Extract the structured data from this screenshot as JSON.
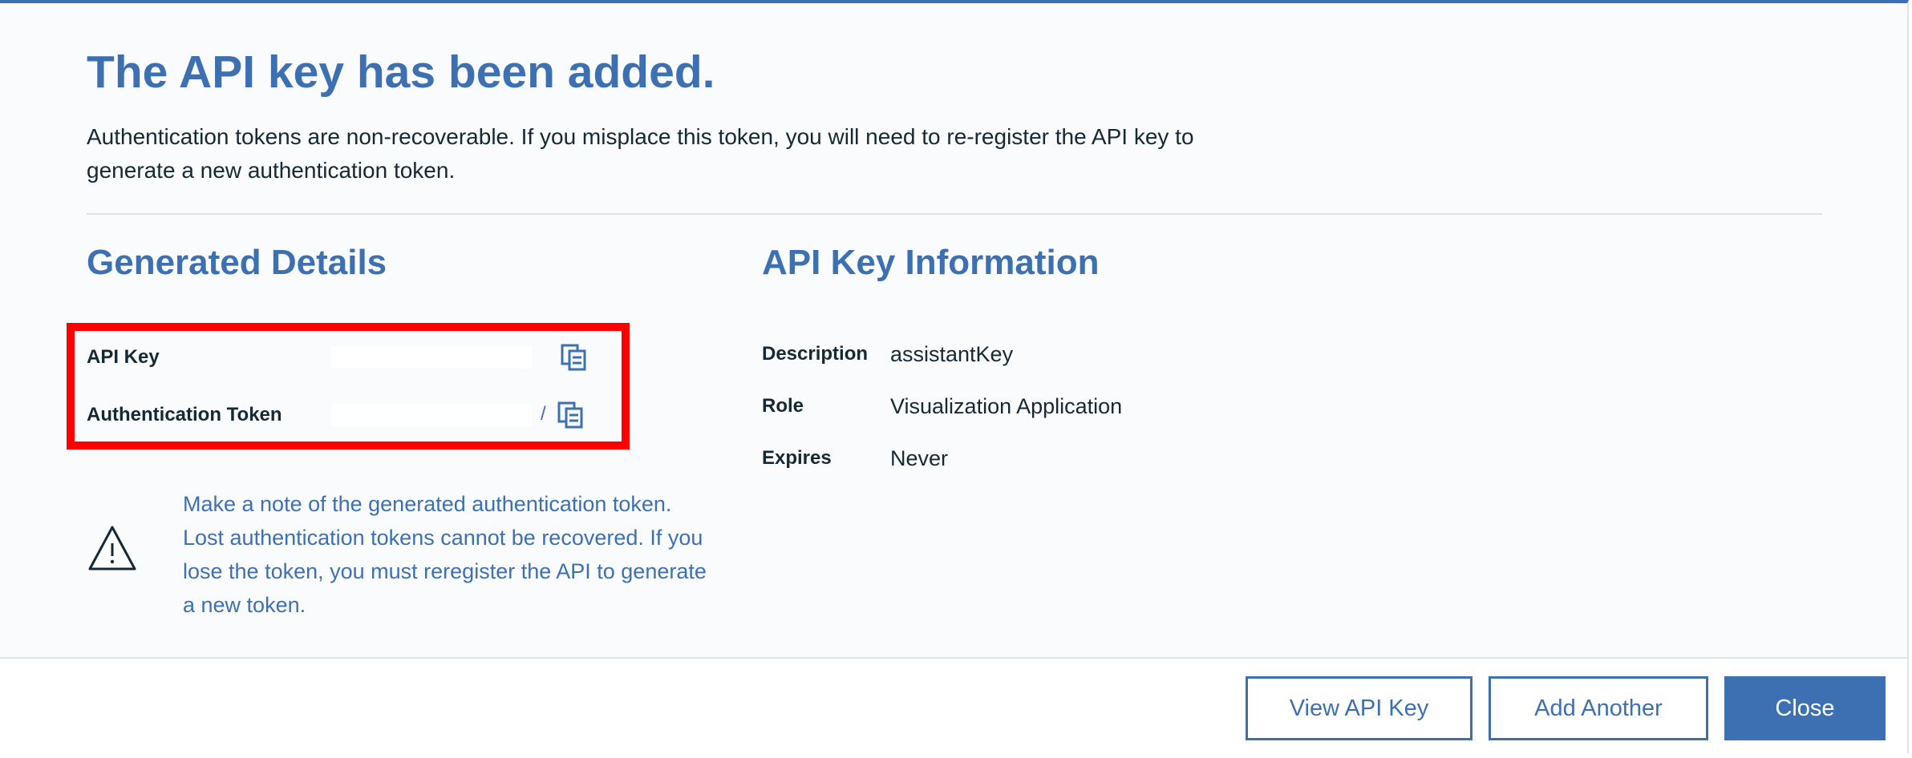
{
  "dialog": {
    "title": "The API key has been added.",
    "intro": "Authentication tokens are non-recoverable. If you misplace this token, you will need to re-register the API key to generate a new authentication token."
  },
  "generated_details": {
    "title": "Generated Details",
    "rows": [
      {
        "label": "API Key",
        "value_tail": ""
      },
      {
        "label": "Authentication Token",
        "value_tail": "/"
      }
    ],
    "copy_icon": "copy-icon",
    "warning": {
      "icon": "warning-triangle-icon",
      "text": "Make a note of the generated authentication token. Lost authentication tokens cannot be recovered. If you lose the token, you must reregister the API to generate a new token."
    }
  },
  "api_key_info": {
    "title": "API Key Information",
    "rows": [
      {
        "label": "Description",
        "value": "assistantKey"
      },
      {
        "label": "Role",
        "value": "Visualization Application"
      },
      {
        "label": "Expires",
        "value": "Never"
      }
    ]
  },
  "footer": {
    "view_label": "View API Key",
    "add_label": "Add Another",
    "close_label": "Close"
  },
  "colors": {
    "accent": "#3d70b2",
    "highlight": "#ff0000",
    "text": "#152935",
    "divider": "#dfe3e6"
  }
}
